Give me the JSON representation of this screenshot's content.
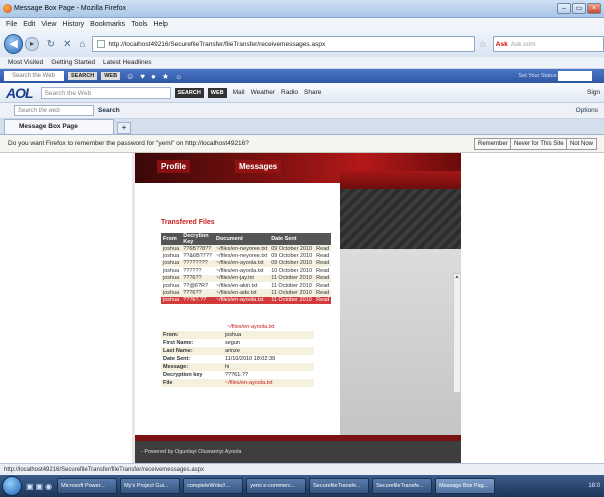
{
  "window": {
    "title": "Message Box Page - Mozilla Firefox",
    "controls": [
      "–",
      "▭",
      "×"
    ]
  },
  "menu": [
    "File",
    "Edit",
    "View",
    "History",
    "Bookmarks",
    "Tools",
    "Help"
  ],
  "nav": {
    "url": "http://localhost49216/SecurefileTransfer/fileTransfer/receivemessages.aspx",
    "search_placeholder": "Ask.com",
    "search_brand": "Ask"
  },
  "bookmarks": [
    "Most Visited",
    "Getting Started",
    "Latest Headlines"
  ],
  "toolbar1": {
    "search_placeholder": "Search the Web",
    "search_btn": "SEARCH",
    "web_btn": "WEB",
    "status_label": "Set Your Status:"
  },
  "aol_bar": {
    "logo": "AOL",
    "search_placeholder": "Search the Web",
    "search_btn": "SEARCH",
    "web_btn": "WEB",
    "items": [
      "Mail",
      "Weather",
      "Radio",
      "Share"
    ],
    "sign_in": "Sign"
  },
  "toolbar3": {
    "search_placeholder": "Search the web",
    "search_btn": "Search",
    "options": "Options"
  },
  "tabs": {
    "active": "Message Box Page",
    "add": "+"
  },
  "password_bar": {
    "message": "Do you want Firefox to remember the password for \"yemi\" on http://localhost49216?",
    "remember": "Remember",
    "never": "Never for This Site",
    "not_now": "Not Now"
  },
  "site": {
    "nav": [
      "Profile",
      "Messages"
    ],
    "section_title": "Transfered Files",
    "table_headers": [
      "From",
      "Decrytion Key",
      "Document",
      "Date Sent",
      ""
    ],
    "rows": [
      [
        "joshua",
        "??6B??8??",
        "~/files/en-neyoree.txt",
        "09 October 2010",
        "Read"
      ],
      [
        "joshua",
        "??&6B?7??",
        "~/files/en-neyoree.txt",
        "09 October 2010",
        "Read"
      ],
      [
        "joshua",
        "????????",
        "~/files/en-ayoola.txt",
        "09 October 2010",
        "Read"
      ],
      [
        "joshua",
        "??????",
        "~/files/en-ayoola.txt",
        "10 October 2010",
        "Read"
      ],
      [
        "joshua",
        "???6??",
        "~/files/en-jay.txt",
        "11 October 2010",
        "Read"
      ],
      [
        "joshua",
        "??@6?R?",
        "~/files/en-akin.txt",
        "11 October 2010",
        "Read"
      ],
      [
        "joshua",
        "???6??",
        "~/files/en-ade.txt",
        "11 October 2010",
        "Read"
      ],
      [
        "joshua",
        "???6?.??",
        "~/files/en-ayoola.txt",
        "11 October 2010",
        "Read"
      ]
    ],
    "selected_link": "~/files/en-ayoola.txt",
    "details": [
      {
        "k": "From:",
        "v": "joshua"
      },
      {
        "k": "First Name:",
        "v": "segun"
      },
      {
        "k": "Last Name:",
        "v": "arinze"
      },
      {
        "k": "Date Sent:",
        "v": "11/10/2010 18:02:39"
      },
      {
        "k": "Message:",
        "v": "hi"
      },
      {
        "k": "Decryption key",
        "v": "???61.??"
      },
      {
        "k": "File",
        "v": "~/files/en-ayoola.txt"
      }
    ],
    "footer": "- Powered by Ogunlayi Oluwamiyi Ayoola"
  },
  "statusbar": "http://localhost49216/SecurefileTransfer/fileTransfer/receivemessages.aspx",
  "taskbar": {
    "tasks": [
      "Microsoft Power...",
      "My's Project Gui...",
      "completeWrite//...",
      "yemi e-commerc...",
      "SecurefileTransfe...",
      "SecurefileTransfe...",
      "Message Box Pag..."
    ],
    "clock": "18:0"
  }
}
